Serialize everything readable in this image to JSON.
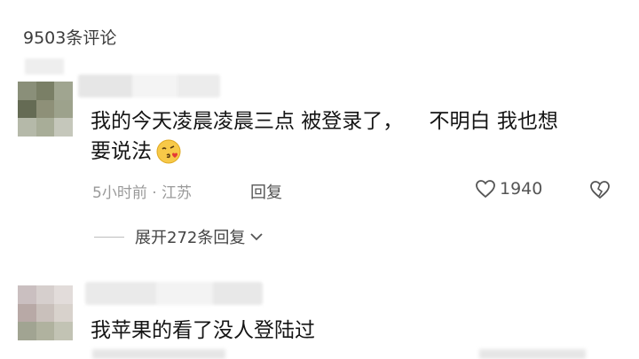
{
  "header": {
    "comment_count": "9503条评论"
  },
  "comments": [
    {
      "text_line1": "我的今天凌晨凌晨三点 被登录了，    不明白 我也想",
      "text_line2": "要说法",
      "emoji_icon": "kiss-face-icon",
      "meta": "5小时前 · 江苏",
      "reply_label": "回复",
      "like_count": "1940",
      "expand_replies": "展开272条回复"
    },
    {
      "text_line1": "我苹果的看了没人登陆过"
    }
  ]
}
